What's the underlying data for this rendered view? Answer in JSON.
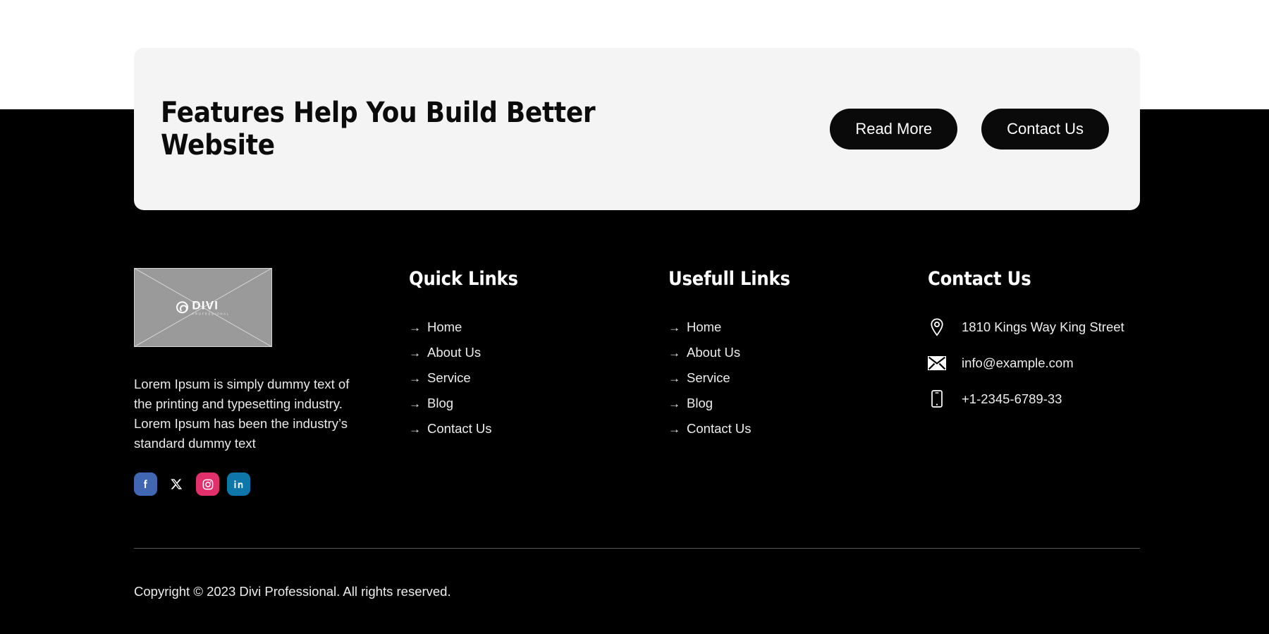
{
  "theme": {
    "page_bg": "#ffffff",
    "panel_bg": "#000000",
    "card_bg": "#f4f4f4",
    "button_bg": "#0a0a0a",
    "text_light": "#ededed",
    "divider": "#555555"
  },
  "cta": {
    "heading": "Features Help You Build Better Website",
    "read_more_label": "Read More",
    "contact_label": "Contact Us"
  },
  "brand": {
    "logo_name": "DIVI",
    "logo_sub": "PROFESSIONAL",
    "logo_alt": "divi-placeholder-logo",
    "description": "Lorem Ipsum is simply dummy text of the printing and typesetting industry. Lorem Ipsum has been the industry’s standard dummy text",
    "social": [
      {
        "name": "facebook",
        "color": "#4267b2"
      },
      {
        "name": "x-twitter",
        "color": "#000000"
      },
      {
        "name": "instagram",
        "color": "#e1306c"
      },
      {
        "name": "linkedin",
        "color": "#0e76a8"
      }
    ]
  },
  "quick_links": {
    "title": "Quick Links",
    "arrow": "→",
    "items": [
      {
        "label": "Home"
      },
      {
        "label": "About Us"
      },
      {
        "label": "Service"
      },
      {
        "label": "Blog"
      },
      {
        "label": "Contact Us"
      }
    ]
  },
  "useful_links": {
    "title": "Usefull Links",
    "arrow": "→",
    "items": [
      {
        "label": "Home"
      },
      {
        "label": "About Us"
      },
      {
        "label": "Service"
      },
      {
        "label": "Blog"
      },
      {
        "label": "Contact Us"
      }
    ]
  },
  "contact": {
    "title": "Contact Us",
    "items": [
      {
        "icon": "map-pin-icon",
        "value": "1810 Kings Way King Street"
      },
      {
        "icon": "envelope-icon",
        "value": "info@example.com"
      },
      {
        "icon": "mobile-phone-icon",
        "value": "+1-2345-6789-33"
      }
    ]
  },
  "footer": {
    "copyright": "Copyright © 2023 Divi Professional. All rights reserved."
  }
}
